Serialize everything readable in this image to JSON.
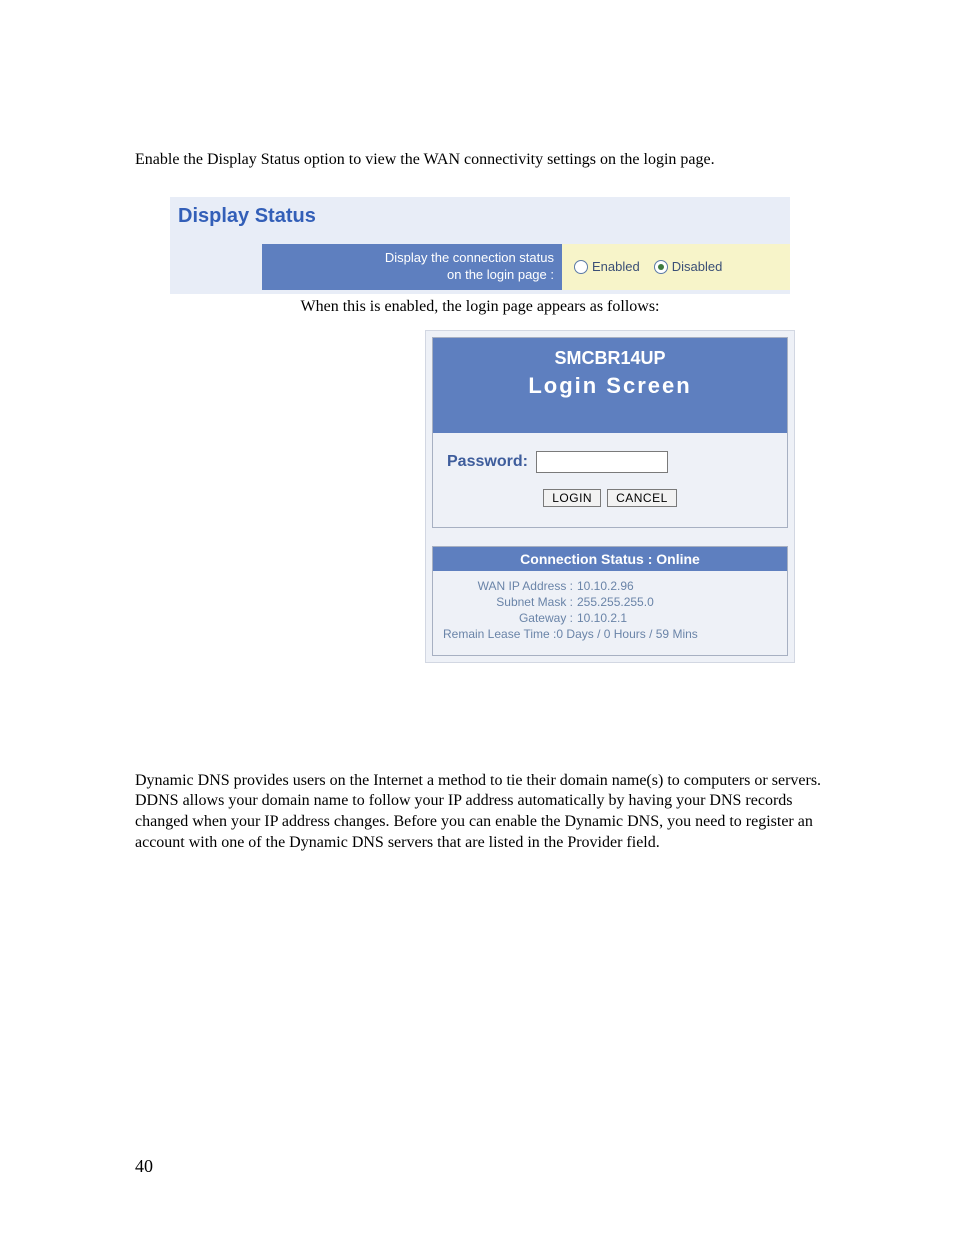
{
  "intro": "Enable the Display Status option to view the WAN connectivity settings on the login page.",
  "display_status": {
    "title": "Display Status",
    "label_line1": "Display the connection status",
    "label_line2": "on the login page :",
    "enabled_label": "Enabled",
    "disabled_label": "Disabled",
    "selected": "Disabled"
  },
  "caption": "When this is enabled, the login page appears as follows:",
  "login": {
    "model": "SMCBR14UP",
    "screen_title": "Login  Screen",
    "password_label": "Password:",
    "login_btn": "LOGIN",
    "cancel_btn": "CANCEL"
  },
  "status": {
    "header": "Connection Status : Online",
    "wan_k": "WAN IP Address :",
    "wan_v": "10.10.2.96",
    "mask_k": "Subnet Mask :",
    "mask_v": "255.255.255.0",
    "gw_k": "Gateway :",
    "gw_v": "10.10.2.1",
    "lease_k": "Remain Lease Time :",
    "lease_v": "0 Days / 0 Hours / 59 Mins"
  },
  "ddns": "Dynamic DNS provides users on the Internet a method to tie their domain name(s) to computers or servers. DDNS allows your domain name to follow your IP address automatically by having your DNS records changed when your IP address changes. Before you can enable the Dynamic DNS, you need to register an account with one of the Dynamic DNS servers that are listed in the Provider field.",
  "page_number": "40"
}
